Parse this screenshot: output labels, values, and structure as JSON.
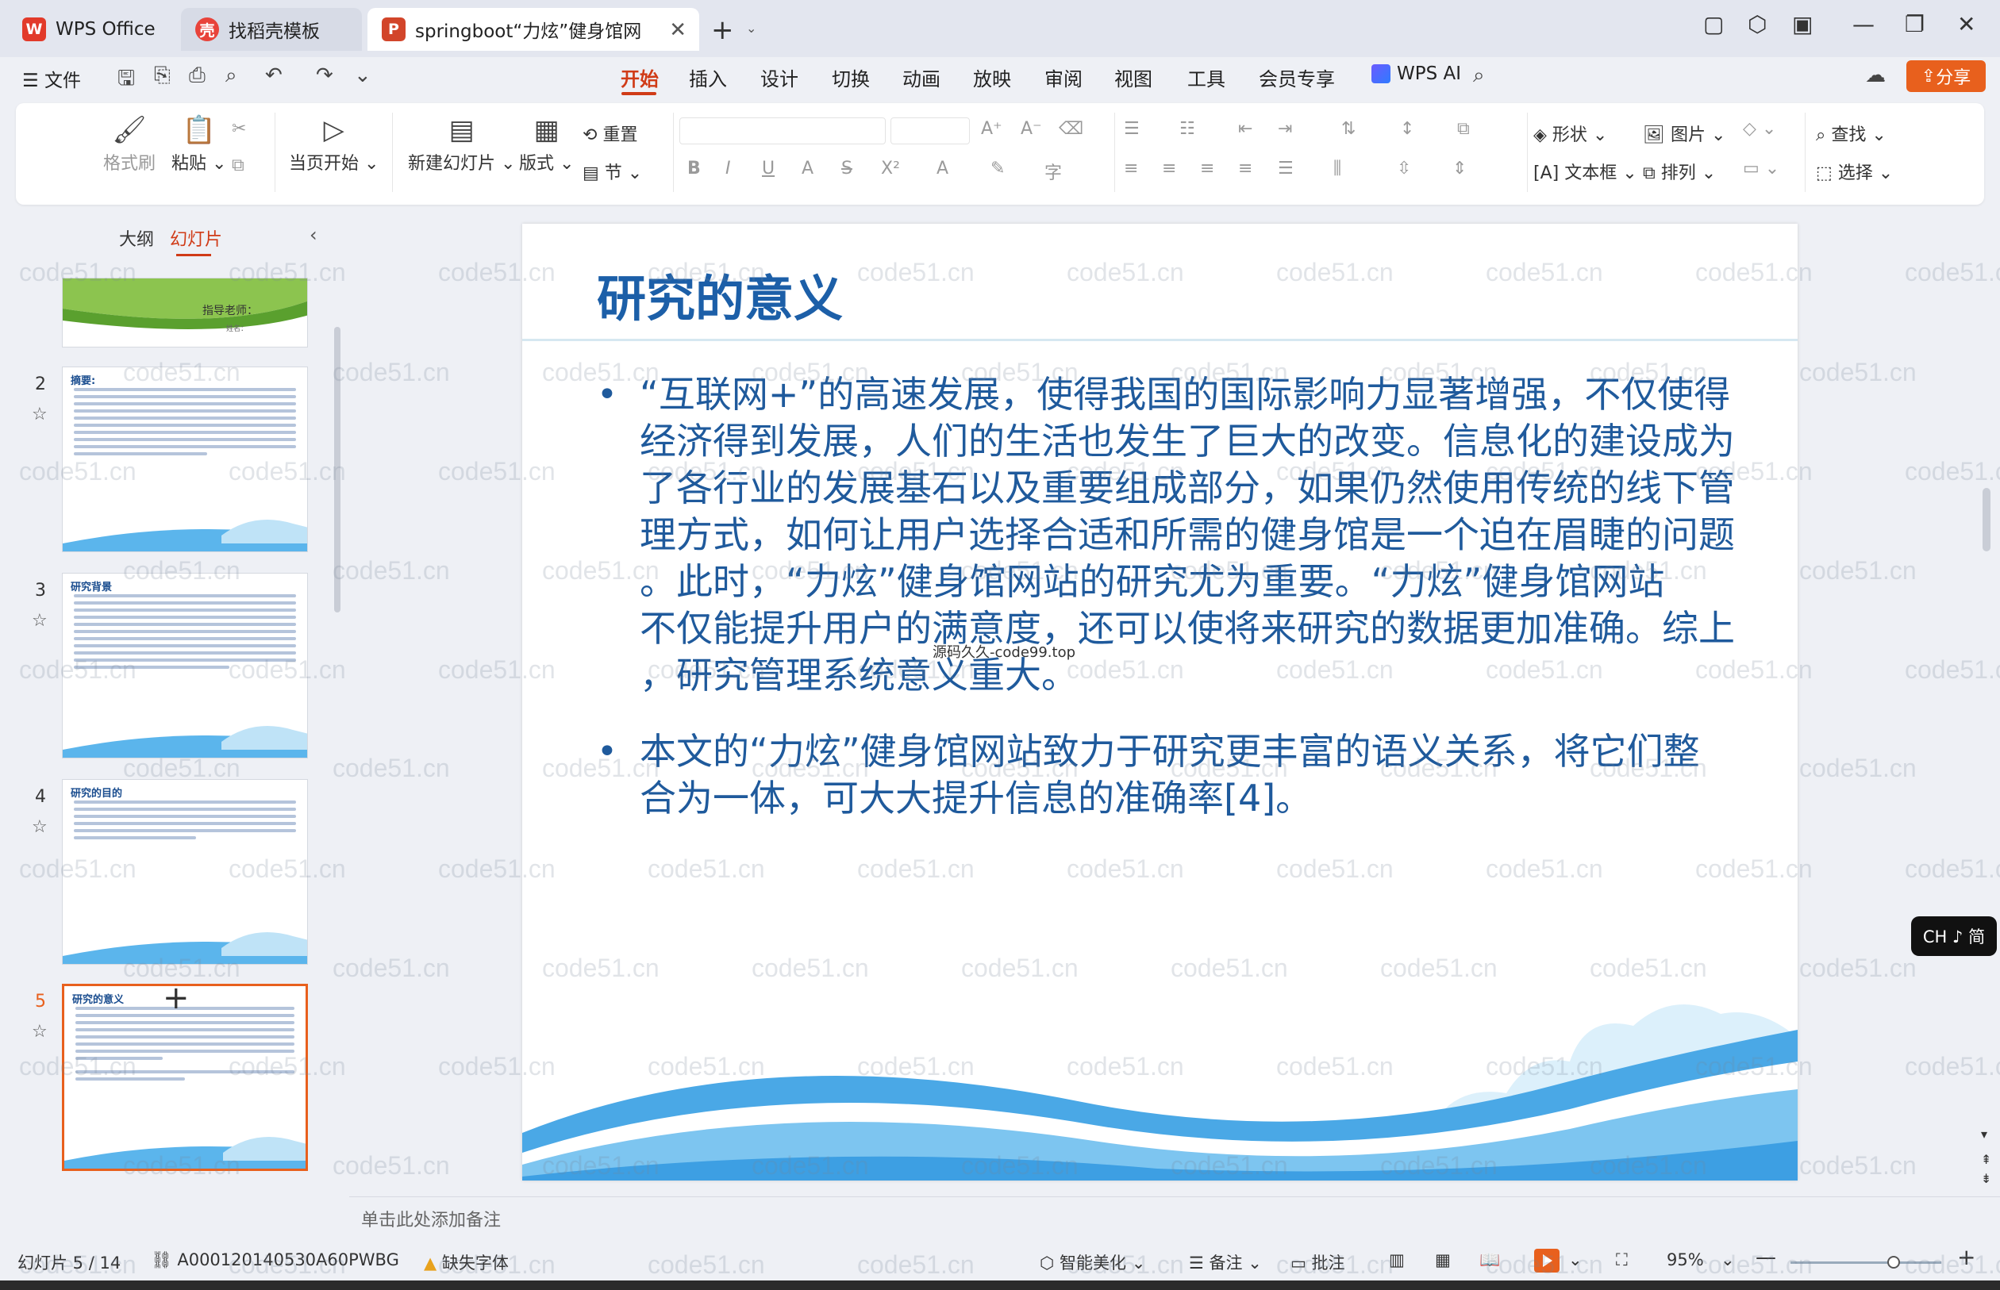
{
  "titlebar": {
    "tabs": [
      {
        "label": "WPS Office",
        "icon": "wps-logo-icon"
      },
      {
        "label": "找稻壳模板",
        "icon": "daoke-icon"
      },
      {
        "label": "springboot“力炫”健身馆网",
        "icon": "ppt-file-icon"
      }
    ]
  },
  "menubar": {
    "file": "文件",
    "items": [
      "开始",
      "插入",
      "设计",
      "切换",
      "动画",
      "放映",
      "审阅",
      "视图",
      "工具",
      "会员专享"
    ],
    "active": "开始",
    "wps_ai": "WPS AI",
    "share": "分享"
  },
  "ribbon": {
    "format_painter": "格式刷",
    "paste": "粘贴",
    "start_from_current": "当页开始",
    "new_slide": "新建幻灯片",
    "layout": "版式",
    "reset": "重置",
    "section": "节",
    "shape": "形状",
    "picture": "图片",
    "find": "查找",
    "textbox": "文本框",
    "arrange": "排列",
    "select": "选择"
  },
  "leftpanel": {
    "tab_outline": "大纲",
    "tab_slides": "幻灯片",
    "thumbnails": [
      {
        "num": "",
        "title": "指导老师：",
        "subtitle": "姓名："
      },
      {
        "num": "2",
        "title": "摘要:"
      },
      {
        "num": "3",
        "title": "研究背景"
      },
      {
        "num": "4",
        "title": "研究的目的"
      },
      {
        "num": "5",
        "title": "研究的意义"
      }
    ]
  },
  "slide": {
    "title": "研究的意义",
    "bullets": [
      "“互联网+”的高速发展，使得我国的国际影响力显著增强，不仅使得经济得到发展，人们的生活也发生了巨大的改变。信息化的建设成为了各行业的发展基石以及重要组成部分，如果仍然使用传统的线下管理方式，如何让用户选择合适和所需的健身馆是一个迫在眉睫的问题。此时，“力炫”健身馆网站的研究尤为重要。“力炫”健身馆网站不仅能提升用户的满意度，还可以使将来研究的数据更加准确。综上，研究管理系统意义重大。",
      "本文的“力炫”健身馆网站致力于研究更丰富的语义关系，将它们整合为一体，可大大提升信息的准确率[4]。"
    ],
    "bullet_lines": [
      [
        "“互联网+”的高速发展，使得我国的国际影响力显著增强，不仅使得",
        "经济得到发展，人们的生活也发生了巨大的改变。信息化的建设成为",
        "了各行业的发展基石以及重要组成部分，如果仍然使用传统的线下管",
        "理方式，如何让用户选择合适和所需的健身馆是一个迫在眉睫的问题",
        "。此时，“力炫”健身馆网站的研究尤为重要。“力炫”健身馆网站",
        "不仅能提升用户的满意度，还可以使将来研究的数据更加准确。综上",
        "，研究管理系统意义重大。"
      ],
      [
        "本文的“力炫”健身馆网站致力于研究更丰富的语义关系，将它们整",
        "合为一体，可大大提升信息的准确率[4]。"
      ]
    ],
    "overlay_text": "源码久久-code99.top"
  },
  "notes_placeholder": "单击此处添加备注",
  "statusbar": {
    "slide_counter": "幻灯片 5 / 14",
    "doc_id": "A000120140530A60PWBG",
    "missing_fonts": "缺失字体",
    "smart_beautify": "智能美化",
    "notes": "备注",
    "comments": "批注",
    "zoom": "95%",
    "zoom_fraction": 0.95
  },
  "ime_indicator": "CH ♪ 简",
  "watermark_text": "code51.cn",
  "colors": {
    "accent": "#d03b17",
    "share": "#e8601d",
    "slide_title": "#1c5fa8",
    "slide_text": "#1f5a9c"
  }
}
